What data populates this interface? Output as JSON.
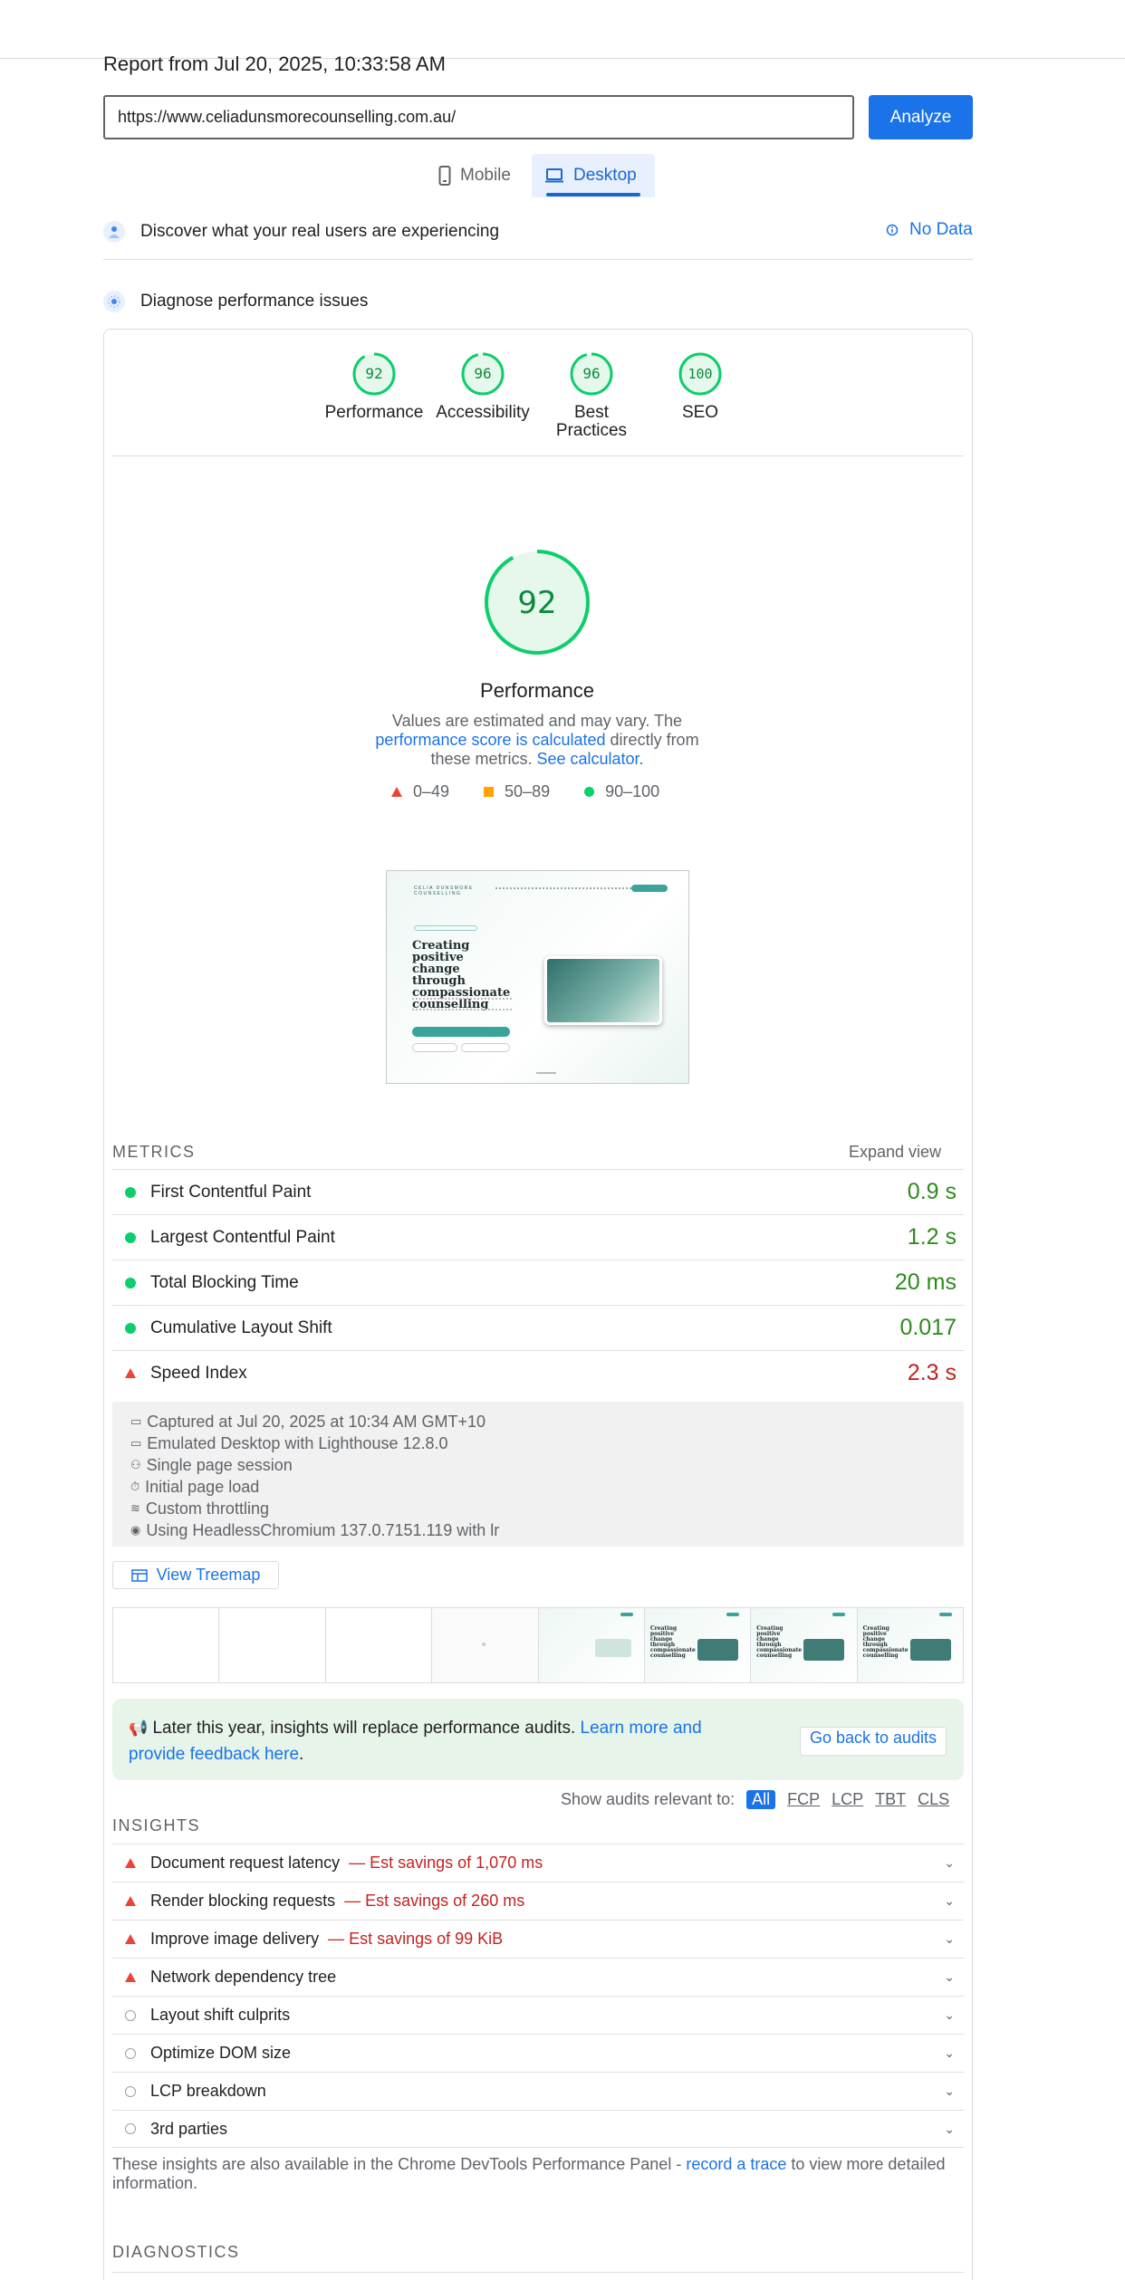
{
  "report": {
    "date": "Report from Jul 20, 2025, 10:33:58 AM",
    "url": "https://www.celiadunsmorecounselling.com.au/",
    "analyze_label": "Analyze"
  },
  "tabs": [
    {
      "label": "Mobile",
      "selected": false
    },
    {
      "label": "Desktop",
      "selected": true
    }
  ],
  "sections": {
    "field_title": "Discover what your real users are experiencing",
    "field_status": "No Data",
    "lab_title": "Diagnose performance issues"
  },
  "scores": [
    {
      "value": "92",
      "label": "Performance"
    },
    {
      "value": "96",
      "label": "Accessibility"
    },
    {
      "value": "96",
      "label": "Best Practices"
    },
    {
      "value": "100",
      "label": "SEO"
    }
  ],
  "performance": {
    "score": "92",
    "score_fraction": 0.92,
    "title": "Performance",
    "desc_pre": "Values are estimated and may vary. The ",
    "desc_link1": "performance score is calculated",
    "desc_mid": " directly from these metrics. ",
    "desc_link2": "See calculator."
  },
  "legend": [
    "0–49",
    "50–89",
    "90–100"
  ],
  "colors": {
    "pass": "#0cce6b",
    "average": "#ffa400",
    "fail": "#eb4335",
    "accent": "#1a73e8"
  },
  "screenshot": {
    "brand": "CELIA DUNSMORE COUNSELLING",
    "headline": "Creating positive change through compassionate counselling"
  },
  "metrics": {
    "header": "METRICS",
    "expand": "Expand view",
    "items": [
      {
        "name": "First Contentful Paint",
        "value": "0.9 s",
        "status": "pass"
      },
      {
        "name": "Largest Contentful Paint",
        "value": "1.2 s",
        "status": "pass"
      },
      {
        "name": "Total Blocking Time",
        "value": "20 ms",
        "status": "pass"
      },
      {
        "name": "Cumulative Layout Shift",
        "value": "0.017",
        "status": "pass"
      },
      {
        "name": "Speed Index",
        "value": "2.3 s",
        "status": "fail"
      }
    ]
  },
  "env": [
    {
      "icon": "calendar-icon",
      "text": "Captured at Jul 20, 2025 at 10:34 AM GMT+10"
    },
    {
      "icon": "laptop-icon",
      "text": "Emulated Desktop with Lighthouse 12.8.0"
    },
    {
      "icon": "session-icon",
      "text": "Single page session"
    },
    {
      "icon": "timer-icon",
      "text": "Initial page load"
    },
    {
      "icon": "wifi-icon",
      "text": "Custom throttling"
    },
    {
      "icon": "chrome-icon",
      "text": "Using HeadlessChromium 137.0.7151.119 with lr"
    }
  ],
  "treemap_label": "View Treemap",
  "notice": {
    "text": "Later this year, insights will replace performance audits. ",
    "link": "Learn more and provide feedback here",
    "end": ".",
    "button": "Go back to audits"
  },
  "audit_filter": {
    "label": "Show audits relevant to:",
    "options": [
      "All",
      "FCP",
      "LCP",
      "TBT",
      "CLS"
    ]
  },
  "insights": {
    "header": "INSIGHTS",
    "items": [
      {
        "name": "Document request latency",
        "savings": "— Est savings of 1,070 ms",
        "status": "fail"
      },
      {
        "name": "Render blocking requests",
        "savings": "— Est savings of 260 ms",
        "status": "fail"
      },
      {
        "name": "Improve image delivery",
        "savings": "— Est savings of 99 KiB",
        "status": "fail"
      },
      {
        "name": "Network dependency tree",
        "savings": "",
        "status": "fail"
      },
      {
        "name": "Layout shift culprits",
        "savings": "",
        "status": "info"
      },
      {
        "name": "Optimize DOM size",
        "savings": "",
        "status": "info"
      },
      {
        "name": "LCP breakdown",
        "savings": "",
        "status": "info"
      },
      {
        "name": "3rd parties",
        "savings": "",
        "status": "info"
      }
    ],
    "footer_pre": "These insights are also available in the Chrome DevTools Performance Panel - ",
    "footer_link": "record a trace",
    "footer_post": " to view more detailed information."
  },
  "diagnostics_header": "DIAGNOSTICS"
}
